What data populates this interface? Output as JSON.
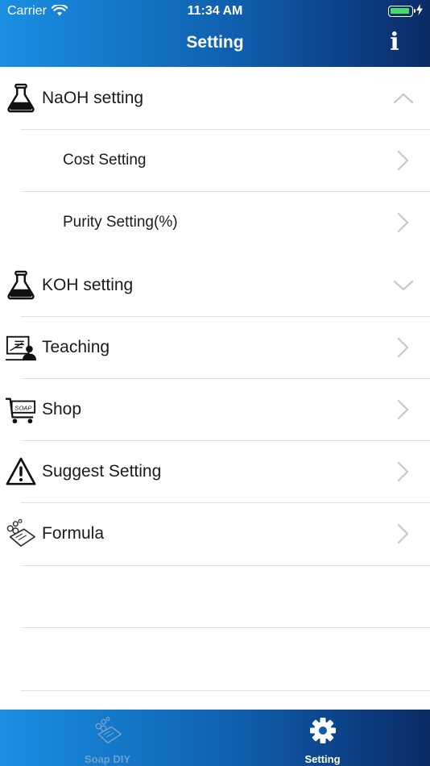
{
  "status": {
    "carrier": "Carrier",
    "time": "11:34 AM"
  },
  "nav": {
    "title": "Setting",
    "info_icon": "info-icon",
    "info_glyph": "i"
  },
  "rows": [
    {
      "label": "NaOH setting",
      "icon": "flask-icon",
      "chevron": "chevron-up-icon"
    },
    {
      "label": "Cost Setting",
      "chevron": "chevron-right-icon"
    },
    {
      "label": "Purity Setting(%)",
      "chevron": "chevron-right-icon"
    },
    {
      "label": "KOH setting",
      "icon": "flask-icon",
      "chevron": "chevron-down-icon"
    },
    {
      "label": "Teaching",
      "icon": "teaching-icon",
      "chevron": "chevron-right-icon"
    },
    {
      "label": "Shop",
      "icon": "shopping-cart-icon",
      "icon_text": "SOAP",
      "chevron": "chevron-right-icon"
    },
    {
      "label": "Suggest Setting",
      "icon": "warning-icon",
      "chevron": "chevron-right-icon"
    },
    {
      "label": "Formula",
      "icon": "soap-bubbles-icon",
      "chevron": "chevron-right-icon"
    }
  ],
  "tabs": [
    {
      "label": "Soap DIY",
      "icon": "soap-bubbles-icon",
      "active": false
    },
    {
      "label": "Setting",
      "icon": "gear-icon",
      "active": true
    }
  ],
  "colors": {
    "bar_start": "#1a8fe3",
    "bar_end": "#0a2a66",
    "separator": "#e1e1e1",
    "chevron": "#c7c7cc",
    "battery": "#4cd964"
  }
}
